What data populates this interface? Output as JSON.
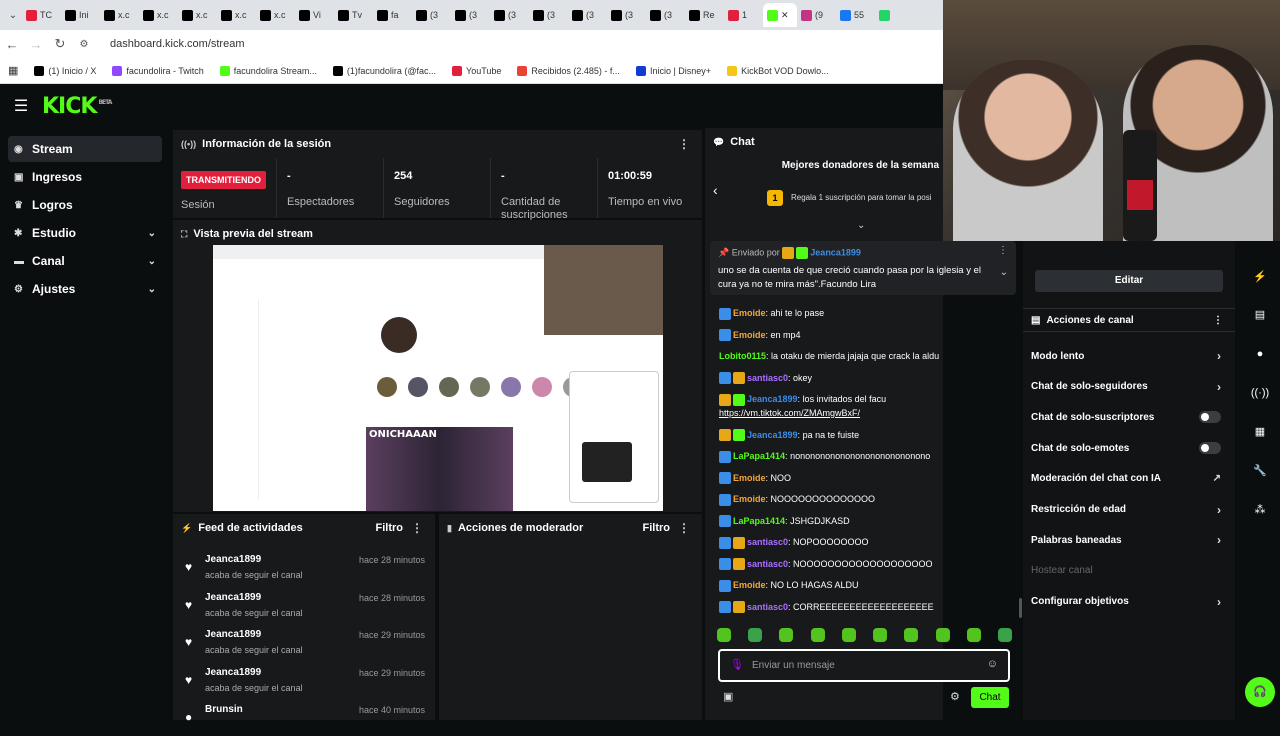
{
  "browser": {
    "tabs": [
      {
        "label": "TC",
        "color": "#e21f3c"
      },
      {
        "label": "Ini",
        "color": "#000000"
      },
      {
        "label": "x.c",
        "color": "#000000"
      },
      {
        "label": "x.c",
        "color": "#000000"
      },
      {
        "label": "x.c",
        "color": "#000000"
      },
      {
        "label": "x.c",
        "color": "#000000"
      },
      {
        "label": "x.c",
        "color": "#000000"
      },
      {
        "label": "Vi",
        "color": "#000000"
      },
      {
        "label": "Tv",
        "color": "#000000"
      },
      {
        "label": "fa",
        "color": "#000000"
      },
      {
        "label": "(3",
        "color": "#000000"
      },
      {
        "label": "(3",
        "color": "#000000"
      },
      {
        "label": "(3",
        "color": "#000000"
      },
      {
        "label": "(3",
        "color": "#000000"
      },
      {
        "label": "(3",
        "color": "#000000"
      },
      {
        "label": "(3",
        "color": "#000000"
      },
      {
        "label": "(3",
        "color": "#000000"
      },
      {
        "label": "Re",
        "color": "#000000"
      },
      {
        "label": "1",
        "color": "#e21f3c"
      },
      {
        "label": "✕",
        "color": "#53fc18",
        "active": true
      },
      {
        "label": "(9",
        "color": "#c13584"
      },
      {
        "label": "55",
        "color": "#1877f2"
      },
      {
        "label": "",
        "color": "#25d366"
      }
    ],
    "url": "dashboard.kick.com/stream",
    "bookmarks": [
      {
        "label": "(1) Inicio / X",
        "color": "#000000"
      },
      {
        "label": "facundolira - Twitch",
        "color": "#9146ff"
      },
      {
        "label": "facundolira Stream...",
        "color": "#53fc18"
      },
      {
        "label": "(1)facundolira (@fac...",
        "color": "#000000"
      },
      {
        "label": "YouTube",
        "color": "#e21f3c"
      },
      {
        "label": "Recibidos (2.485) - f...",
        "color": "#ea4335"
      },
      {
        "label": "Inicio | Disney+",
        "color": "#113ccf"
      },
      {
        "label": "KickBot VOD Dowlo...",
        "color": "#f5c518"
      }
    ]
  },
  "app": {
    "logo": "KICK",
    "logo_sup": "BETA"
  },
  "sidebar": {
    "items": [
      {
        "label": "Stream",
        "icon": "broadcast-icon",
        "active": true
      },
      {
        "label": "Ingresos",
        "icon": "wallet-icon"
      },
      {
        "label": "Logros",
        "icon": "trophy-icon"
      },
      {
        "label": "Estudio",
        "icon": "tools-icon",
        "expandable": true
      },
      {
        "label": "Canal",
        "icon": "monitor-icon",
        "expandable": true
      },
      {
        "label": "Ajustes",
        "icon": "gear-icon",
        "expandable": true
      }
    ]
  },
  "session": {
    "title": "Información de la sesión",
    "live_badge": "TRANSMITIENDO",
    "session_label": "Sesión",
    "stats": [
      {
        "value": "-",
        "label": "Espectadores"
      },
      {
        "value": "254",
        "label": "Seguidores"
      },
      {
        "value": "-",
        "label": "Cantidad de suscripciones"
      },
      {
        "value": "01:00:59",
        "label": "Tiempo en vivo"
      }
    ]
  },
  "preview": {
    "title": "Vista previa del stream",
    "inner_text": "ONICHAAAN"
  },
  "feed": {
    "title": "Feed de actividades",
    "filter": "Filtro",
    "items": [
      {
        "name": "Jeanca1899",
        "action": "acaba de seguir el canal",
        "time": "hace 28 minutos"
      },
      {
        "name": "Jeanca1899",
        "action": "acaba de seguir el canal",
        "time": "hace 28 minutos"
      },
      {
        "name": "Jeanca1899",
        "action": "acaba de seguir el canal",
        "time": "hace 29 minutos"
      },
      {
        "name": "Jeanca1899",
        "action": "acaba de seguir el canal",
        "time": "hace 29 minutos"
      },
      {
        "name": "Brunsin",
        "action": "",
        "time": "hace 40 minutos"
      }
    ]
  },
  "mod": {
    "title": "Acciones de moderador",
    "filter": "Filtro"
  },
  "chat": {
    "title": "Chat",
    "donors_title": "Mejores donadores de la semana",
    "donor_rank": "1",
    "donor_text": "Regala 1 suscripción para tomar la posi",
    "pinned_by": "Enviado por",
    "pinned_user": "Jeanca1899",
    "pinned_text": "uno se da cuenta de que creció cuando pasa por la iglesia y el cura ya no te mira más\".Facundo Lira",
    "messages": [
      {
        "user": "Emoide",
        "color": "#f7a638",
        "text": "ahi te lo pase",
        "icons": [
          "#3b8ee8"
        ]
      },
      {
        "user": "Emoide",
        "color": "#f7a638",
        "text": "en mp4",
        "icons": [
          "#3b8ee8"
        ]
      },
      {
        "user": "Lobito0115",
        "color": "#53fc18",
        "text": "la otaku de mierda jajaja que crack la aldu",
        "icons": []
      },
      {
        "user": "santiasc0",
        "color": "#a970ff",
        "text": "okey",
        "icons": [
          "#3b8ee8",
          "#e6a817"
        ]
      },
      {
        "user": "Jeanca1899",
        "color": "#3b8ee8",
        "text": "los invitados del facu",
        "link": "https://vm.tiktok.com/ZMAmgwBxF/",
        "icons": [
          "#e6a817",
          "#53fc18"
        ]
      },
      {
        "user": "Jeanca1899",
        "color": "#3b8ee8",
        "text": "pa na te fuiste",
        "icons": [
          "#e6a817",
          "#53fc18"
        ]
      },
      {
        "user": "LaPapa1414",
        "color": "#53fc18",
        "text": "nononononononononononononono",
        "icons": [
          "#3b8ee8"
        ]
      },
      {
        "user": "Emoide",
        "color": "#f7a638",
        "text": "NOO",
        "icons": [
          "#3b8ee8"
        ]
      },
      {
        "user": "Emoide",
        "color": "#f7a638",
        "text": "NOOOOOOOOOOOOOO",
        "icons": [
          "#3b8ee8"
        ]
      },
      {
        "user": "LaPapa1414",
        "color": "#53fc18",
        "text": "JSHGDJKASD",
        "icons": [
          "#3b8ee8"
        ]
      },
      {
        "user": "santiasc0",
        "color": "#a970ff",
        "text": "NOPOOOOOOOO",
        "icons": [
          "#3b8ee8",
          "#e6a817"
        ]
      },
      {
        "user": "santiasc0",
        "color": "#a970ff",
        "text": "NOOOOOOOOOOOOOOOOOOO",
        "icons": [
          "#3b8ee8",
          "#e6a817"
        ]
      },
      {
        "user": "Emoide",
        "color": "#f7a638",
        "text": "NO LO HAGAS ALDU",
        "icons": [
          "#3b8ee8"
        ]
      },
      {
        "user": "santiasc0",
        "color": "#a970ff",
        "text": "CORREEEEEEEEEEEEEEEEEEE",
        "icons": [
          "#3b8ee8",
          "#e6a817"
        ]
      }
    ],
    "input_placeholder": "Enviar un mensaje",
    "send_label": "Chat"
  },
  "channel_actions": {
    "edit_label": "Editar",
    "title": "Acciones de canal",
    "items": [
      {
        "label": "Modo lento",
        "kind": "chevron"
      },
      {
        "label": "Chat de solo-seguidores",
        "kind": "chevron"
      },
      {
        "label": "Chat de solo-suscriptores",
        "kind": "toggle"
      },
      {
        "label": "Chat de solo-emotes",
        "kind": "toggle"
      },
      {
        "label": "Moderación del chat con IA",
        "kind": "external"
      },
      {
        "label": "Restricción de edad",
        "kind": "chevron"
      },
      {
        "label": "Palabras baneadas",
        "kind": "chevron"
      },
      {
        "label": "Hostear canal",
        "kind": "disabled"
      },
      {
        "label": "Configurar objetivos",
        "kind": "chevron"
      }
    ]
  },
  "colors": {
    "kick_green": "#53fc18",
    "live_red": "#e21f3c",
    "panel": "#18191b",
    "bg": "#0b0e0f"
  }
}
